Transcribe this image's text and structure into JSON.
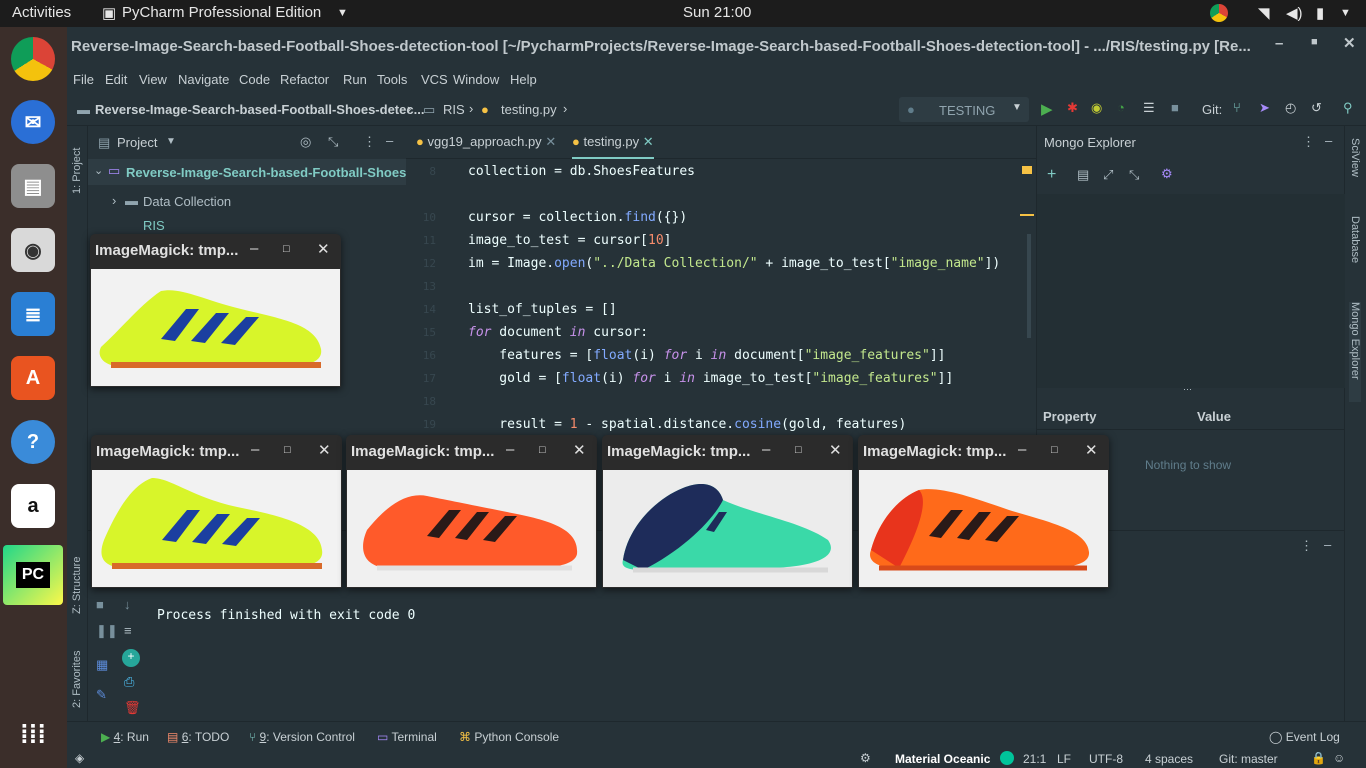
{
  "topbar": {
    "activities": "Activities",
    "app": "PyCharm Professional Edition",
    "clock": "Sun 21:00"
  },
  "window_title": "Reverse-Image-Search-based-Football-Shoes-detection-tool [~/PycharmProjects/Reverse-Image-Search-based-Football-Shoes-detection-tool] - .../RIS/testing.py [Re...",
  "menu": [
    "File",
    "Edit",
    "View",
    "Navigate",
    "Code",
    "Refactor",
    "Run",
    "Tools",
    "VCS",
    "Window",
    "Help"
  ],
  "breadcrumb": {
    "project": "Reverse-Image-Search-based-Football-Shoes-detec...",
    "folder": "RIS",
    "file": "testing.py"
  },
  "run_config": "TESTING",
  "git_label": "Git:",
  "project_panel": {
    "title": "Project",
    "root": "Reverse-Image-Search-based-Football-Shoes-det",
    "item1": "Data Collection",
    "item2": "RIS"
  },
  "tabs": [
    "vgg19_approach.py",
    "testing.py"
  ],
  "code": {
    "n8": "8",
    "n10": "10",
    "n11": "11",
    "n12": "12",
    "n13": "13",
    "n14": "14",
    "n15": "15",
    "n16": "16",
    "n17": "17",
    "n18": "18",
    "n19": "19"
  },
  "mongo": {
    "title": "Mongo Explorer",
    "col_property": "Property",
    "col_value": "Value",
    "empty": "Nothing to show"
  },
  "run_output": "Process finished with exit code 0",
  "left_tools": {
    "project": "1: Project",
    "structure": "Z: Structure",
    "favorites": "2: Favorites"
  },
  "right_tools": {
    "sciview": "SciView",
    "database": "Database",
    "mongo": "Mongo Explorer"
  },
  "bottom_tabs": [
    {
      "num": "4",
      "label": ": Run"
    },
    {
      "num": "6",
      "label": ": TODO"
    },
    {
      "num": "9",
      "label": ": Version Control"
    },
    {
      "num": "",
      "label": "Terminal"
    },
    {
      "num": "",
      "label": "Python Console"
    }
  ],
  "event_log": "Event Log",
  "status": {
    "theme": "Material Oceanic",
    "pos": "21:1",
    "lf": "LF",
    "enc": "UTF-8",
    "indent": "4 spaces",
    "git": "Git: master"
  },
  "imagemagick_title": "ImageMagick: tmp...",
  "colors": {
    "accent": "#80cbc4",
    "bg": "#263238",
    "shoe_yellow": "#d8f52a",
    "shoe_red": "#ff5a2a",
    "shoe_teal": "#3ad9a8"
  }
}
